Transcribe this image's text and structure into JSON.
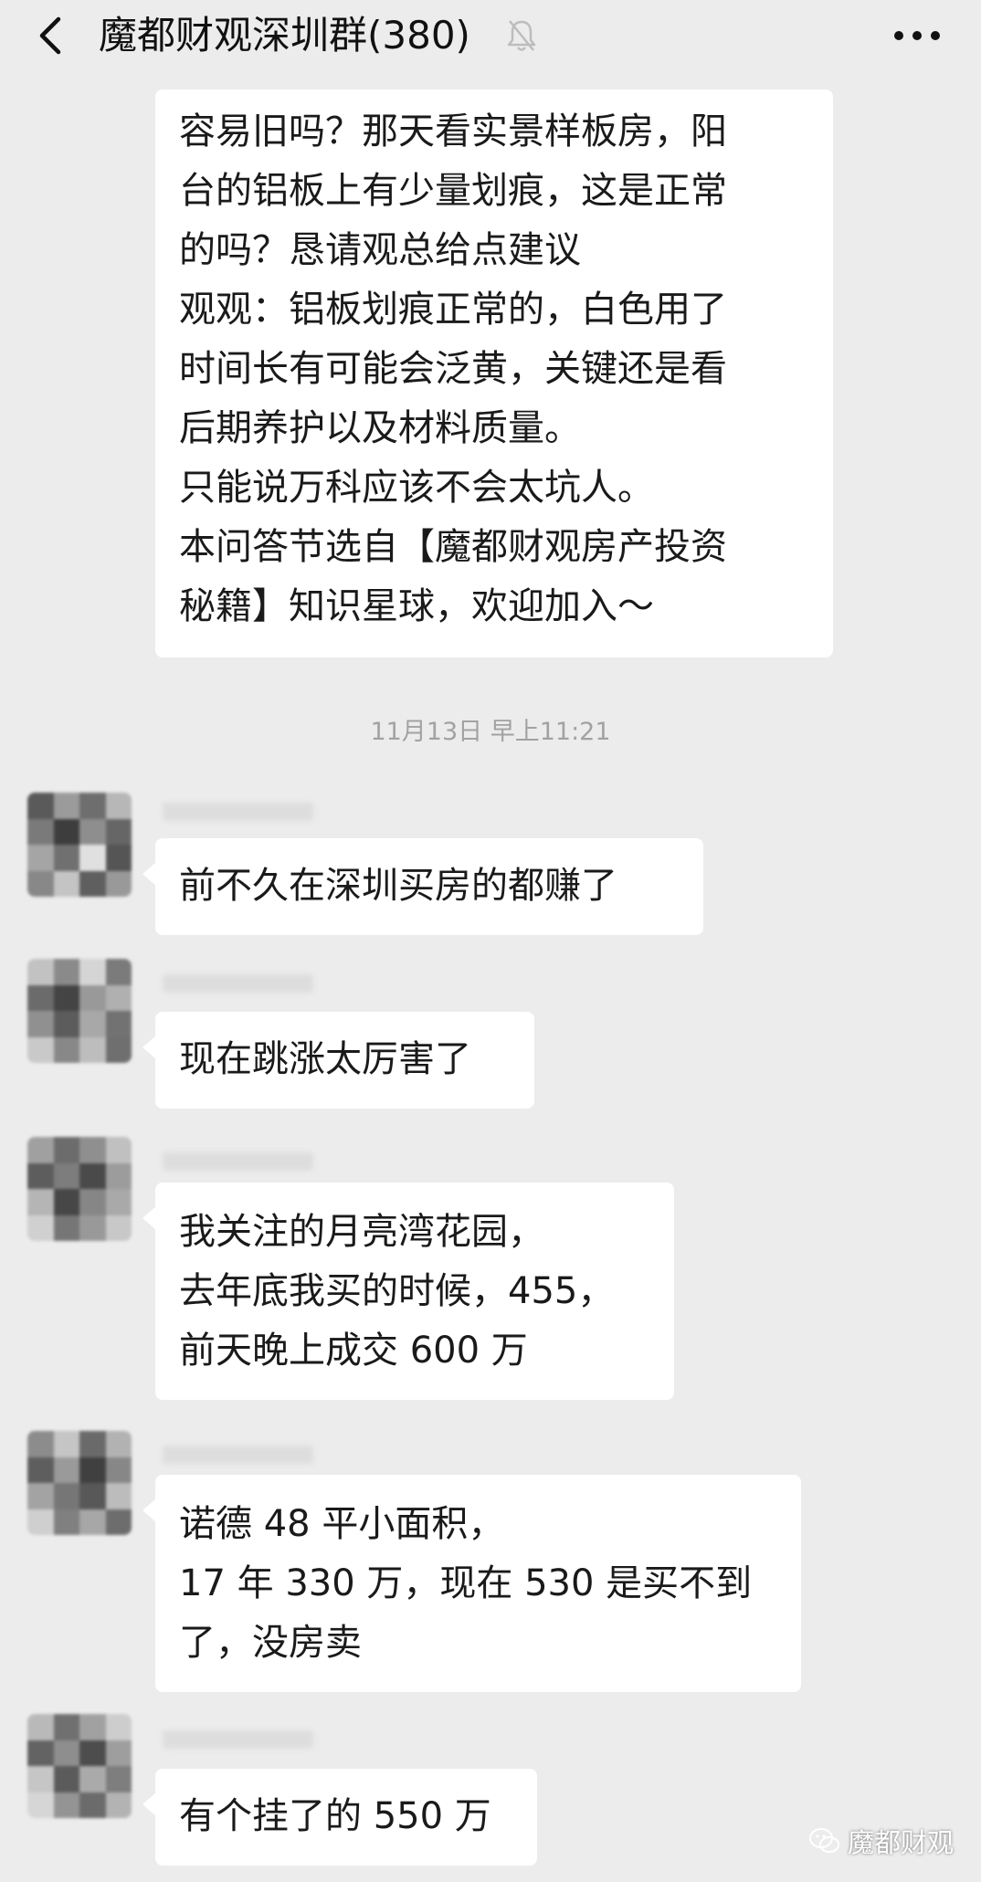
{
  "header": {
    "title": "魔都财观深圳群(380)",
    "back_icon": "chevron-left-icon",
    "mute_icon": "bell-off-icon",
    "more_icon": "more-horizontal-icon"
  },
  "first_message": {
    "lines": [
      "容易旧吗？那天看实景样板房，阳",
      "台的铝板上有少量划痕，这是正常",
      "的吗？恳请观总给点建议",
      "观观：铝板划痕正常的，白色用了",
      "时间长有可能会泛黄，关键还是看",
      "后期养护以及材料质量。",
      "只能说万科应该不会太坑人。",
      "本问答节选自【魔都财观房产投资",
      "秘籍】知识星球，欢迎加入～"
    ]
  },
  "timestamp": "11月13日 早上11:21",
  "messages": [
    {
      "lines": [
        "前不久在深圳买房的都赚了"
      ]
    },
    {
      "lines": [
        "现在跳涨太厉害了"
      ]
    },
    {
      "lines": [
        "我关注的月亮湾花园，",
        "去年底我买的时候，455，",
        "前天晚上成交 600 万"
      ]
    },
    {
      "lines": [
        "诺德 48 平小面积，",
        "17 年 330 万，现在 530 是买不到",
        "了，没房卖"
      ]
    },
    {
      "lines": [
        "有个挂了的 550 万"
      ]
    }
  ],
  "watermark": {
    "text": "魔都财观",
    "icon": "wechat-icon"
  },
  "colors": {
    "background": "#ececec",
    "bubble": "#ffffff",
    "timestamp": "#a2a2a2"
  }
}
